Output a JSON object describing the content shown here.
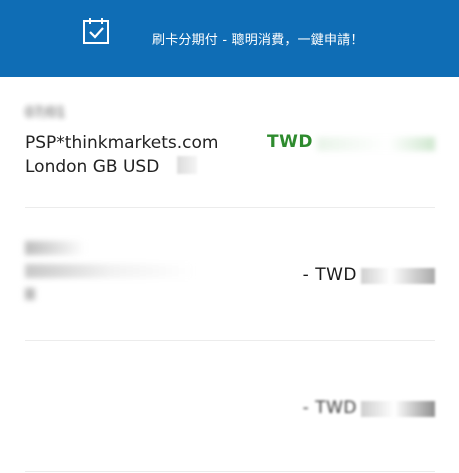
{
  "banner": {
    "text": "刷卡分期付 - 聰明消費，一鍵申請！",
    "icon": "calendar-check-icon",
    "background_color": "#0f6db5"
  },
  "transactions": [
    {
      "date": "07/01",
      "merchant_line1": "PSP*thinkmarkets.com",
      "merchant_line2": "London GB USD",
      "amount": "TWD",
      "amount_color": "#2e8b2e"
    },
    {
      "date": "",
      "merchant_line1": "",
      "merchant_line2": "",
      "amount": "- TWD",
      "amount_color": "#1a1a1a"
    },
    {
      "date": "",
      "merchant_line1": "",
      "merchant_line2": "",
      "amount": "- TWD",
      "amount_color": "#1a1a1a"
    }
  ]
}
